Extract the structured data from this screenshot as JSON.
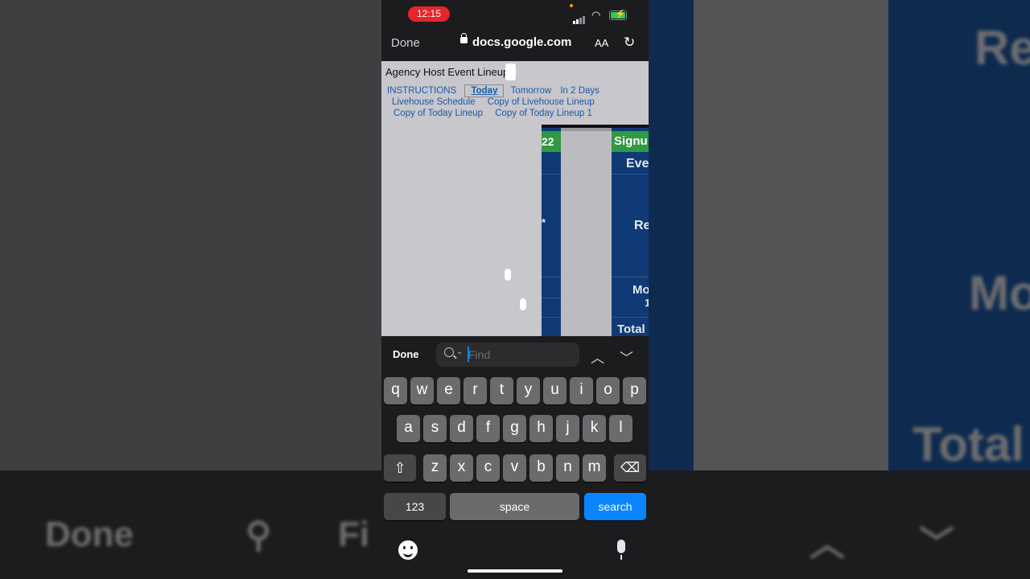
{
  "status": {
    "time": "12:15"
  },
  "browser": {
    "done_label": "Done",
    "domain": "docs.google.com",
    "text_size_label": "AA"
  },
  "doc": {
    "title": "Agency Host Event Lineups",
    "tabs": [
      "INSTRUCTIONS",
      "Today",
      "Tomorrow",
      "In 2 Days",
      "Livehouse Schedule",
      "Copy of Livehouse Lineup",
      "Copy of Today Lineup",
      "Copy of Today Lineup 1"
    ],
    "active_tab": "Today",
    "cells": {
      "col1_header": "22",
      "col1_star": "*",
      "col2_header": "Signu",
      "col2_row1": "Eve",
      "col2_row2": "Re",
      "col2_row3": "Mo",
      "col2_row3b": "1",
      "col2_row4": "Total"
    }
  },
  "find": {
    "done_label": "Done",
    "placeholder": "Find"
  },
  "keyboard": {
    "row1": [
      "q",
      "w",
      "e",
      "r",
      "t",
      "y",
      "u",
      "i",
      "o",
      "p"
    ],
    "row2": [
      "a",
      "s",
      "d",
      "f",
      "g",
      "h",
      "j",
      "k",
      "l"
    ],
    "row3": [
      "z",
      "x",
      "c",
      "v",
      "b",
      "n",
      "m"
    ],
    "numbers_label": "123",
    "space_label": "space",
    "search_label": "search"
  },
  "background": {
    "left_text": "Done",
    "find_text": "Fi",
    "right_top": "Re",
    "right_mid": "Mo",
    "right_bottom": "Total"
  },
  "colors": {
    "accent": "#0a84ff",
    "sheet_blue": "#0f3a75",
    "sheet_green": "#2f9a43",
    "recording": "#e5252a"
  }
}
